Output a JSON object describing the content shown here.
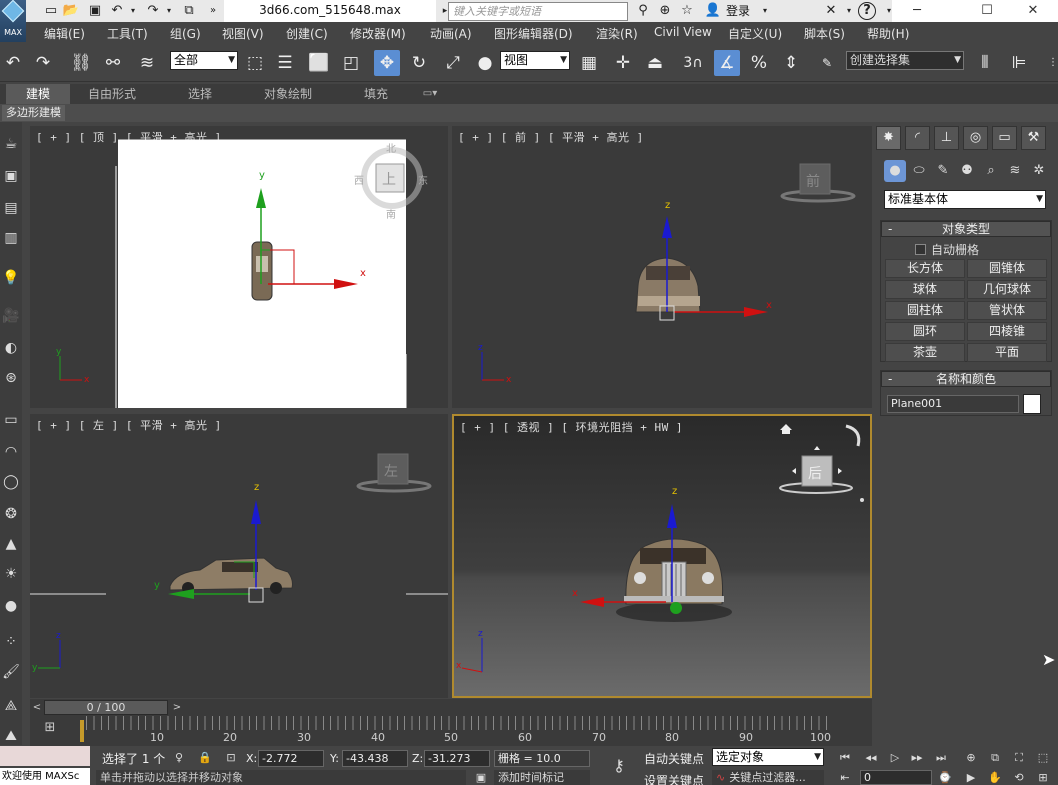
{
  "titlebar": {
    "logo_text": "MAX",
    "document_title": "3d66.com_515648.max",
    "search_placeholder": "键入关键字或短语",
    "login_label": "登录",
    "help_label": "?"
  },
  "menu": {
    "items": [
      "编辑(E)",
      "工具(T)",
      "组(G)",
      "视图(V)",
      "创建(C)",
      "修改器(M)",
      "动画(A)",
      "图形编辑器(D)",
      "渲染(R)",
      "Civil View",
      "自定义(U)",
      "脚本(S)",
      "帮助(H)"
    ]
  },
  "toolbar": {
    "selection_filter": "全部",
    "reference_coord": "视图",
    "snap_number": "3",
    "named_selection": "创建选择集"
  },
  "ribbon": {
    "tabs": [
      "建模",
      "自由形式",
      "选择",
      "对象绘制",
      "填充"
    ],
    "active_tab": "建模",
    "sub_tab": "多边形建模"
  },
  "viewports": {
    "top": {
      "label": "[ + ] [ 顶 ] [ 平滑 + 高光 ]",
      "viewcube_face": "上",
      "compass": {
        "n": "北",
        "s": "南",
        "e": "东",
        "w": "西"
      }
    },
    "front": {
      "label": "[ + ] [ 前 ] [ 平滑 + 高光 ]",
      "viewcube_face": "前"
    },
    "left": {
      "label": "[ + ] [ 左 ] [ 平滑 + 高光 ]",
      "viewcube_face": "左"
    },
    "perspective": {
      "label": "[ + ] [ 透视 ] [ 环境光阻挡 + HW ]",
      "viewcube_face": "后"
    },
    "axis": {
      "x": "x",
      "y": "y",
      "z": "z"
    }
  },
  "command_panel": {
    "category_dropdown": "标准基本体",
    "object_type_title": "对象类型",
    "autogrid_label": "自动栅格",
    "object_buttons": [
      "长方体",
      "圆锥体",
      "球体",
      "几何球体",
      "圆柱体",
      "管状体",
      "圆环",
      "四棱锥",
      "茶壶",
      "平面"
    ],
    "name_color_title": "名称和颜色",
    "object_name": "Plane001",
    "object_color": "#ffffff"
  },
  "timeline": {
    "frame_display": "0 / 100",
    "ticks": [
      "10",
      "20",
      "30",
      "40",
      "50",
      "60",
      "70",
      "80",
      "90",
      "100"
    ]
  },
  "status": {
    "selection_count": "选择了 1 个",
    "x_label": "X:",
    "x_value": "-2.772",
    "y_label": "Y:",
    "y_value": "-43.438",
    "z_label": "Z:",
    "z_value": "-31.273",
    "grid_label": "栅格 = 10.0",
    "prompt": "单击并拖动以选择并移动对象",
    "add_time_tag": "添加时间标记",
    "welcome": "欢迎使用 MAXSc",
    "auto_key": "自动关键点",
    "set_key": "设置关键点",
    "key_mode_dropdown": "选定对象",
    "key_filters": "关键点过滤器...",
    "current_frame": "0"
  },
  "colors": {
    "accent_blue": "#5b8ed3",
    "active_viewport_border": "#b08a2e",
    "axis_x": "#d01010",
    "axis_y": "#1ea01e",
    "axis_z": "#1a1ad0"
  }
}
